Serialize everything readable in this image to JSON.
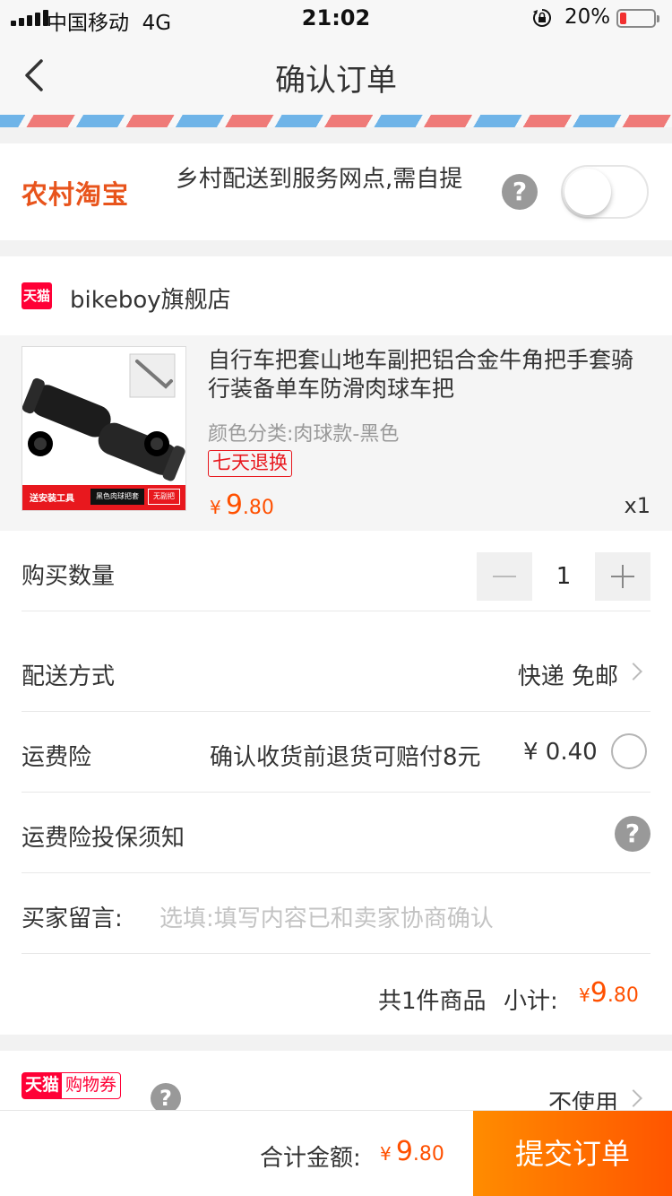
{
  "status_bar": {
    "carrier": "中国移动",
    "network": "4G",
    "time": "21:02",
    "battery_percent": "20%",
    "battery_level": 0.2,
    "battery_color": "#f23030"
  },
  "nav": {
    "title": "确认订单",
    "back_icon": "chevron-left-icon"
  },
  "rural": {
    "logo": "农村淘宝",
    "text": "乡村配送到服务网点,需自提",
    "help": "?",
    "toggle_on": false
  },
  "store": {
    "badge": "天猫",
    "name": "bikeboy旗舰店"
  },
  "product": {
    "title": "自行车把套山地车副把铝合金牛角把手套骑行装备单车防滑肉球车把",
    "spec": "颜色分类:肉球款-黑色",
    "badge": "七天退换",
    "price_currency": "¥",
    "price_int": "9",
    "price_dec": ".80",
    "qty": "x1",
    "image_banner_left": "送安装工具",
    "image_banner_mid": "黑色肉球把套",
    "image_banner_right": "无副把"
  },
  "quantity": {
    "label": "购买数量",
    "value": "1"
  },
  "shipping": {
    "label": "配送方式",
    "value": "快递 免邮"
  },
  "insurance": {
    "label": "运费险",
    "desc": "确认收货前退货可赔付8元",
    "price": "¥ 0.40",
    "selected": false
  },
  "insurance_notice": {
    "label": "运费险投保须知",
    "help": "?"
  },
  "message": {
    "label": "买家留言:",
    "placeholder": "选填:填写内容已和卖家协商确认"
  },
  "subtotal": {
    "count_text": "共1件商品",
    "label": "小计:",
    "currency": "¥",
    "int": "9",
    "dec": ".80"
  },
  "coupon": {
    "tag_a": "天猫",
    "tag_b": "购物券",
    "help": "?",
    "value": "不使用"
  },
  "footer": {
    "total_label": "合计金额:",
    "currency": "¥",
    "int": "9",
    "dec": ".80",
    "submit": "提交订单"
  },
  "colors": {
    "accent": "#ff5000",
    "tmall_red": "#ff0036",
    "submit_gradient": [
      "#ff8c00",
      "#ff5500"
    ]
  }
}
